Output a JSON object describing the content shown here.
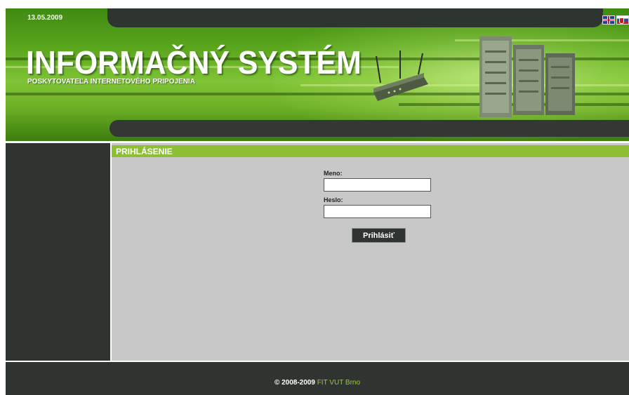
{
  "header": {
    "date": "13.05.2009",
    "title": "INFORMAČNÝ SYSTÉM",
    "subtitle": "POSKYTOVATEĽA INTERNETOVÉHO PRIPOJENIA",
    "languages": [
      {
        "code": "en",
        "icon": "uk-flag-icon"
      },
      {
        "code": "sk",
        "icon": "slovak-flag-icon"
      }
    ],
    "colors": {
      "brand_green": "#6db027",
      "dark_bar": "#2f3430"
    }
  },
  "section": {
    "title": "PRIHLÁSENIE"
  },
  "login": {
    "username_label": "Meno:",
    "username_value": "",
    "password_label": "Heslo:",
    "password_value": "",
    "submit_label": "Prihlásiť"
  },
  "footer": {
    "copyright": "© 2008-2009",
    "link_text": "FIT VUT Brno",
    "link_color": "#9acd32"
  }
}
